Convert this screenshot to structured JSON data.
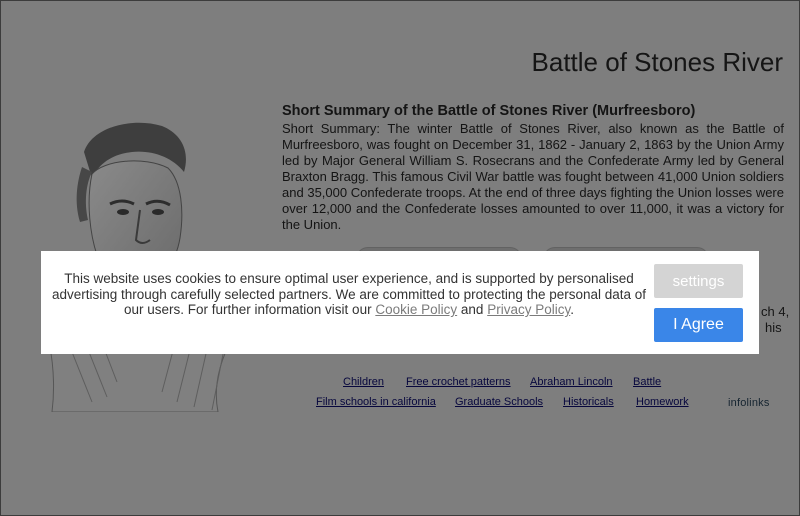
{
  "page": {
    "title": "Battle of Stones River"
  },
  "summary": {
    "heading": "Short Summary of the Battle of Stones River (Murfreesboro)",
    "body": "Short Summary: The winter Battle of Stones River, also known as the Battle of Murfreesboro, was fought on December 31, 1862 - January 2, 1863 by the Union Army led by Major General William S. Rosecrans and the Confederate Army led by General Braxton Bragg. This famous Civil War battle was fought between 41,000 Union soldiers and 35,000 Confederate troops. At the end of three days fighting the Union losses were over 12,000 and the Confederate losses amounted to over 11,000,  it was a victory for the Union."
  },
  "peek": {
    "line1_end": "ch 4,",
    "line2_end": "his"
  },
  "links": {
    "row1": [
      "Children",
      "Free crochet patterns",
      "Abraham Lincoln",
      "Battle"
    ],
    "row2": [
      "Film schools in california",
      "Graduate Schools",
      "Historicals",
      "Homework"
    ],
    "brand": "infolinks"
  },
  "cookie": {
    "text_before": "This website uses cookies to ensure optimal user experience, and is supported by personalised advertising through carefully selected partners. We are committed to protecting the personal data of our users. For further information visit our",
    "cookie_policy": "Cookie Policy",
    "and": "and",
    "privacy_policy": "Privacy Policy",
    "period": ".",
    "settings_label": "settings",
    "agree_label": "I Agree"
  },
  "colors": {
    "overlay": "#7e7e7e",
    "agree_button": "#3a86e8",
    "settings_button": "#d4d4d4",
    "link": "#07073d"
  },
  "icons": {
    "portrait": "abraham-lincoln-engraving"
  }
}
